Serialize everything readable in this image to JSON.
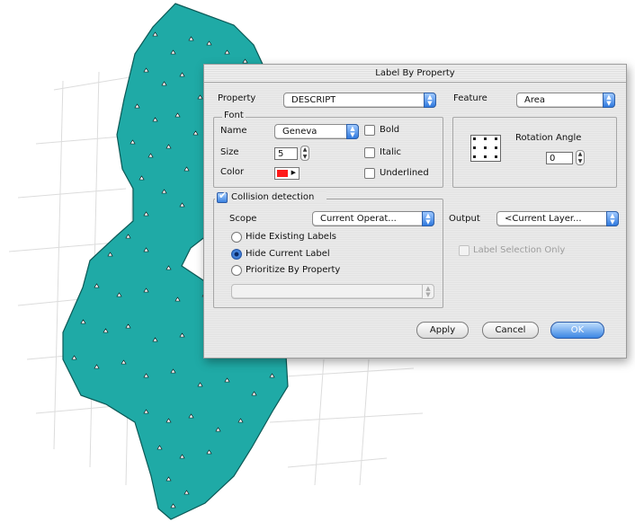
{
  "dialog": {
    "title": "Label By Property",
    "property": {
      "label": "Property",
      "value": "DESCRIPT"
    },
    "font": {
      "group_title": "Font",
      "name_label": "Name",
      "name_value": "Geneva",
      "size_label": "Size",
      "size_value": "5",
      "color_label": "Color",
      "color_value": "#ff1a1a",
      "bold_label": "Bold",
      "italic_label": "Italic",
      "underlined_label": "Underlined"
    },
    "feature": {
      "label": "Feature",
      "value": "Area"
    },
    "rotation": {
      "label": "Rotation Angle",
      "value": "0"
    },
    "collision": {
      "label": "Collision detection",
      "scope_label": "Scope",
      "scope_value": "Current Operat...",
      "options": [
        "Hide Existing Labels",
        "Hide Current Label",
        "Prioritize By Property"
      ],
      "selected_option": "Hide Current Label",
      "property_popup_value": ""
    },
    "output": {
      "label": "Output",
      "value": "<Current Layer...",
      "selection_only_label": "Label Selection Only"
    },
    "buttons": {
      "apply": "Apply",
      "cancel": "Cancel",
      "ok": "OK"
    }
  },
  "colors": {
    "map_fill": "#1faaa6",
    "accent_blue": "#3b86e3"
  }
}
